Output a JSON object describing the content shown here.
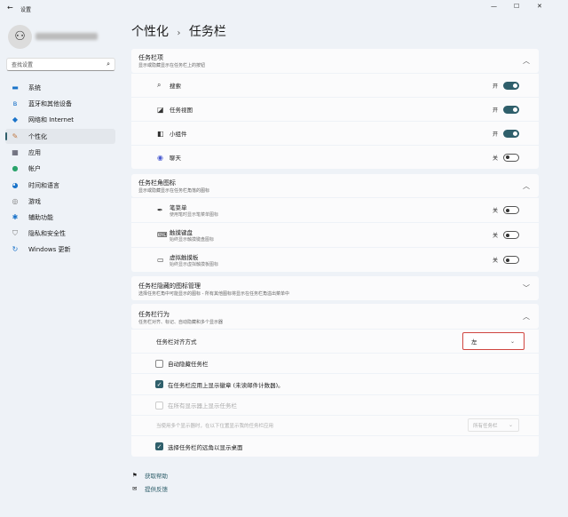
{
  "window": {
    "title": "设置",
    "back": "←",
    "controls": [
      "—",
      "☐",
      "✕"
    ]
  },
  "search": {
    "placeholder": "查找设置"
  },
  "sidebar": {
    "items": [
      {
        "label": "系统",
        "icon": "▬",
        "color": "#1a73c9"
      },
      {
        "label": "蓝牙和其他设备",
        "icon": "ʙ",
        "color": "#1a73c9"
      },
      {
        "label": "网络和 Internet",
        "icon": "◆",
        "color": "#1a73c9"
      },
      {
        "label": "个性化",
        "icon": "✎",
        "color": "#c07a44"
      },
      {
        "label": "应用",
        "icon": "▦",
        "color": "#445"
      },
      {
        "label": "帐户",
        "icon": "●",
        "color": "#2aa36b"
      },
      {
        "label": "时间和语言",
        "icon": "◕",
        "color": "#1a73c9"
      },
      {
        "label": "游戏",
        "icon": "◎",
        "color": "#777"
      },
      {
        "label": "辅助功能",
        "icon": "✱",
        "color": "#1a73c9"
      },
      {
        "label": "隐私和安全性",
        "icon": "⛉",
        "color": "#777"
      },
      {
        "label": "Windows 更新",
        "icon": "↻",
        "color": "#1a73c9"
      }
    ]
  },
  "breadcrumb": {
    "parent": "个性化",
    "sep": "›",
    "current": "任务栏"
  },
  "sections": {
    "items": {
      "title": "任务栏项",
      "subtitle": "显示或隐藏显示在任务栏上的按钮",
      "rows": [
        {
          "label": "搜索",
          "state": "开",
          "icon": "⌕"
        },
        {
          "label": "任务视图",
          "state": "开",
          "icon": "◪"
        },
        {
          "label": "小组件",
          "state": "开",
          "icon": "◧"
        },
        {
          "label": "聊天",
          "state": "关",
          "icon": "◉"
        }
      ]
    },
    "corner": {
      "title": "任务栏角图标",
      "subtitle": "显示或隐藏显示在任务栏角落的图标",
      "rows": [
        {
          "label": "笔菜单",
          "sub": "使用笔时显示笔菜单图标",
          "state": "关",
          "icon": "✒"
        },
        {
          "label": "触摸键盘",
          "sub": "始终显示触摸键盘图标",
          "state": "关",
          "icon": "⌨"
        },
        {
          "label": "虚拟触摸板",
          "sub": "始终显示虚拟触摸板图标",
          "state": "关",
          "icon": "▭"
        }
      ]
    },
    "overflow": {
      "title": "任务栏隐藏的图标管理",
      "subtitle": "选择任务栏角中可能显示的图标 - 所有其他图标将显示在任务栏角溢出菜单中"
    },
    "behavior": {
      "title": "任务栏行为",
      "subtitle": "任务栏对齐、标记、自动隐藏和多个显示器",
      "alignment_label": "任务栏对齐方式",
      "alignment_value": "左",
      "autohide": "自动隐藏任务栏",
      "badges": "在任务栏应用上显示徽章 (未读邮件计数器)。",
      "all_displays": "在所有显示器上显示任务栏",
      "multi_label": "当使用多个显示器时，在以下位置显示我的任务栏应用",
      "multi_value": "所有任务栏",
      "far_corner": "选择任务栏的远角以显示桌面"
    }
  },
  "footer": {
    "help": "获取帮助",
    "feedback": "提供反馈"
  }
}
